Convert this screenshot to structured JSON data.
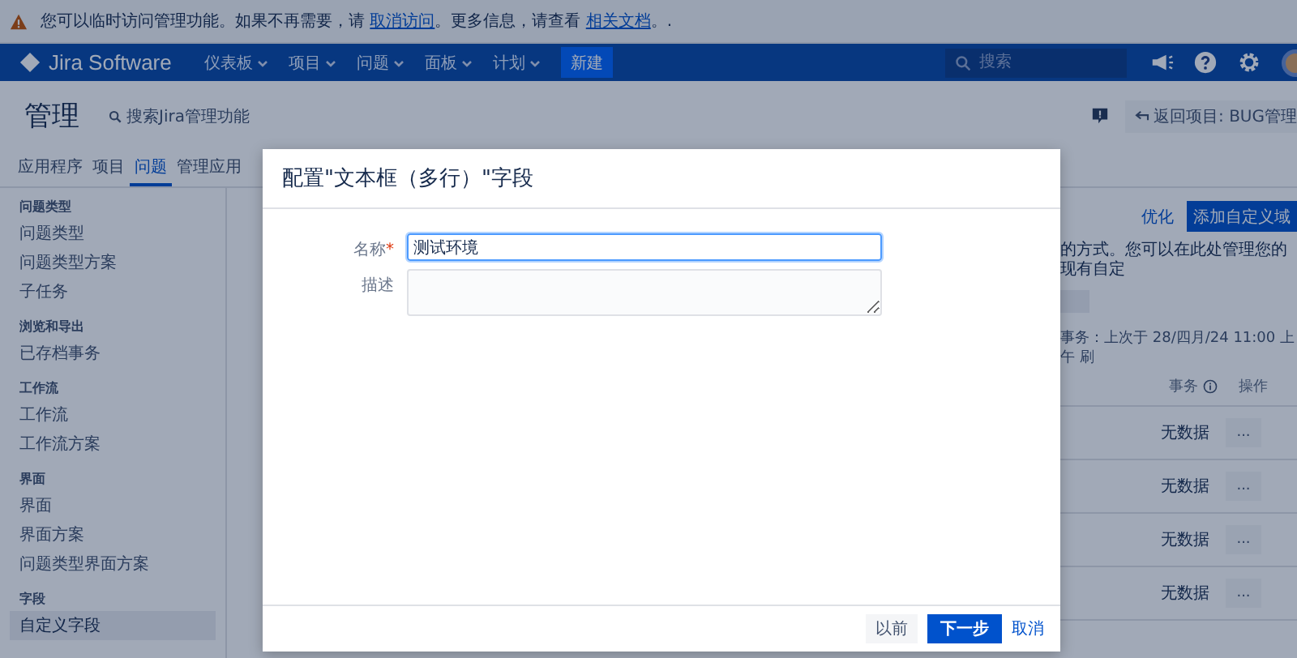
{
  "banner": {
    "text_before": "您可以临时访问管理功能。如果不再需要，请 ",
    "link_1": "取消访问",
    "text_middle": "。更多信息，请查看 ",
    "link_2": "相关文档",
    "text_after": "。."
  },
  "nav": {
    "logo": "Jira Software",
    "menus": [
      "仪表板",
      "项目",
      "问题",
      "面板",
      "计划"
    ],
    "create_button": "新建",
    "search_placeholder": "搜索"
  },
  "admin": {
    "title": "管理",
    "search_label": "搜索Jira管理功能",
    "back_link": "返回项目: BUG管理"
  },
  "tabs": [
    {
      "label": "应用程序",
      "selected": false
    },
    {
      "label": "项目",
      "selected": false
    },
    {
      "label": "问题",
      "selected": true
    },
    {
      "label": "管理应用",
      "selected": false
    }
  ],
  "sidebar": [
    {
      "heading": "问题类型",
      "items": [
        {
          "label": "问题类型",
          "selected": false
        },
        {
          "label": "问题类型方案",
          "selected": false
        },
        {
          "label": "子任务",
          "selected": false
        }
      ]
    },
    {
      "heading": "浏览和导出",
      "items": [
        {
          "label": "已存档事务",
          "selected": false
        }
      ]
    },
    {
      "heading": "工作流",
      "items": [
        {
          "label": "工作流",
          "selected": false
        },
        {
          "label": "工作流方案",
          "selected": false
        }
      ]
    },
    {
      "heading": "界面",
      "items": [
        {
          "label": "界面",
          "selected": false
        },
        {
          "label": "界面方案",
          "selected": false
        },
        {
          "label": "问题类型界面方案",
          "selected": false
        }
      ]
    },
    {
      "heading": "字段",
      "items": [
        {
          "label": "自定义字段",
          "selected": true
        }
      ]
    }
  ],
  "content": {
    "optimize_link": "优化",
    "add_button": "添加自定义域",
    "description": "的方式。您可以在此处管理您的现有自定",
    "refresh_note": "事务：上次于 28/四月/24 11:00 上午 刷",
    "columns": [
      "事务",
      "操作"
    ],
    "rows": [
      {
        "events": "无数据",
        "action": "..."
      },
      {
        "events": "无数据",
        "action": "..."
      },
      {
        "events": "无数据",
        "action": "..."
      },
      {
        "events": "无数据",
        "action": "..."
      }
    ]
  },
  "dialog": {
    "title": "配置\"文本框（多行）\"字段",
    "fields": [
      {
        "label": "名称",
        "required_mark": "*",
        "kind": "input",
        "value": "测试环境"
      },
      {
        "label": "描述",
        "kind": "textarea"
      }
    ],
    "buttons": [
      {
        "label": "以前",
        "kind": "secondary"
      },
      {
        "label": "下一步",
        "kind": "primary"
      },
      {
        "label": "取消",
        "kind": "link"
      }
    ]
  }
}
